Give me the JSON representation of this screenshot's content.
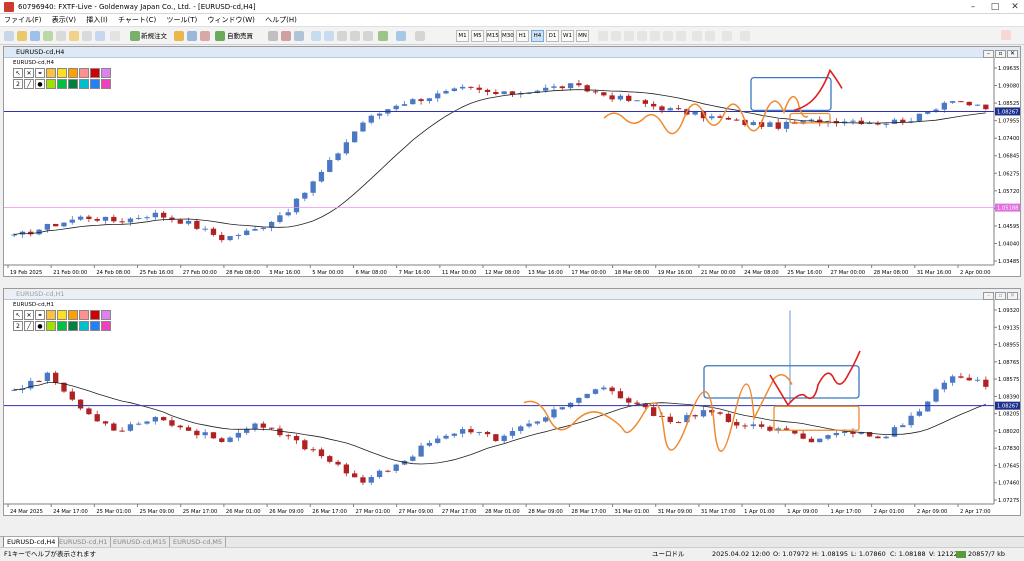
{
  "window": {
    "title": "60796940: FXTF-Live - Goldenway Japan Co., Ltd. - [EURUSD-cd,H4]"
  },
  "menu": [
    "ファイル(F)",
    "表示(V)",
    "挿入(I)",
    "チャート(C)",
    "ツール(T)",
    "ウィンドウ(W)",
    "ヘルプ(H)"
  ],
  "toolbar": {
    "new_order": "新規注文",
    "auto_trade": "自動売買",
    "timeframes": [
      "M1",
      "M5",
      "M15",
      "M30",
      "H1",
      "H4",
      "D1",
      "W1",
      "MN"
    ],
    "active_timeframe": "H4"
  },
  "charts": [
    {
      "window_title": "EURUSD-cd,H4",
      "symbol_label": "EURUSD-cd,H4",
      "price_axis": [
        "1.09635",
        "1.09080",
        "1.08525",
        "1.07955",
        "1.07400",
        "1.06845",
        "1.06275",
        "1.05720",
        "1.05165",
        "1.04595",
        "1.04040",
        "1.03485"
      ],
      "price_min": 1.0335,
      "price_max": 1.0985,
      "current_price_tag": "1.08267",
      "current_price": 1.08267,
      "pink_price_tag": "1.05188",
      "pink_price": 1.05188,
      "time_axis": [
        "19 Feb 2025",
        "21 Feb 00:00",
        "24 Feb 08:00",
        "25 Feb 16:00",
        "27 Feb 00:00",
        "28 Feb 08:00",
        "3 Mar 16:00",
        "5 Mar 00:00",
        "6 Mar 08:00",
        "7 Mar 16:00",
        "11 Mar 00:00",
        "12 Mar 08:00",
        "13 Mar 16:00",
        "17 Mar 00:00",
        "18 Mar 08:00",
        "19 Mar 16:00",
        "21 Mar 00:00",
        "24 Mar 08:00",
        "25 Mar 16:00",
        "27 Mar 00:00",
        "28 Mar 08:00",
        "31 Mar 16:00",
        "2 Apr 00:00"
      ]
    },
    {
      "window_title": "EURUSD-cd,H1",
      "symbol_label": "EURUSD-cd,H1",
      "price_axis": [
        "1.09320",
        "1.09135",
        "1.08955",
        "1.08765",
        "1.08575",
        "1.08390",
        "1.08205",
        "1.08020",
        "1.07830",
        "1.07645",
        "1.07460",
        "1.07275"
      ],
      "price_min": 1.072,
      "price_max": 1.0937,
      "current_price_tag": "1.08267",
      "current_price": 1.08267,
      "time_axis": [
        "24 Mar 2025",
        "24 Mar 17:00",
        "25 Mar 01:00",
        "25 Mar 09:00",
        "25 Mar 17:00",
        "26 Mar 01:00",
        "26 Mar 09:00",
        "26 Mar 17:00",
        "27 Mar 01:00",
        "27 Mar 09:00",
        "27 Mar 17:00",
        "28 Mar 01:00",
        "28 Mar 09:00",
        "28 Mar 17:00",
        "31 Mar 01:00",
        "31 Mar 09:00",
        "31 Mar 17:00",
        "1 Apr 01:00",
        "1 Apr 09:00",
        "1 Apr 17:00",
        "2 Apr 01:00",
        "2 Apr 09:00",
        "2 Apr 17:00"
      ]
    }
  ],
  "tabs": [
    "EURUSD-cd,H4",
    "EURUSD-cd,H1",
    "EURUSD-cd,M15",
    "EURUSD-cd,M5"
  ],
  "status": {
    "help": "F1キーでヘルプが表示されます",
    "profile": "ユーロドル",
    "datetime": "2025.04.02 12:00",
    "open": "O: 1.07972",
    "high": "H: 1.08195",
    "low": "L: 1.07860",
    "close": "C: 1.08188",
    "volume": "V: 12122",
    "traffic": "20857/7 kb"
  },
  "colors": {
    "bull": "#4a78c4",
    "bear": "#b02222",
    "ma": "#202020",
    "price_line": "#3030b0",
    "annotation_orange": "#f08a30",
    "annotation_red": "#e02020",
    "annotation_blue": "#3a78c0"
  }
}
